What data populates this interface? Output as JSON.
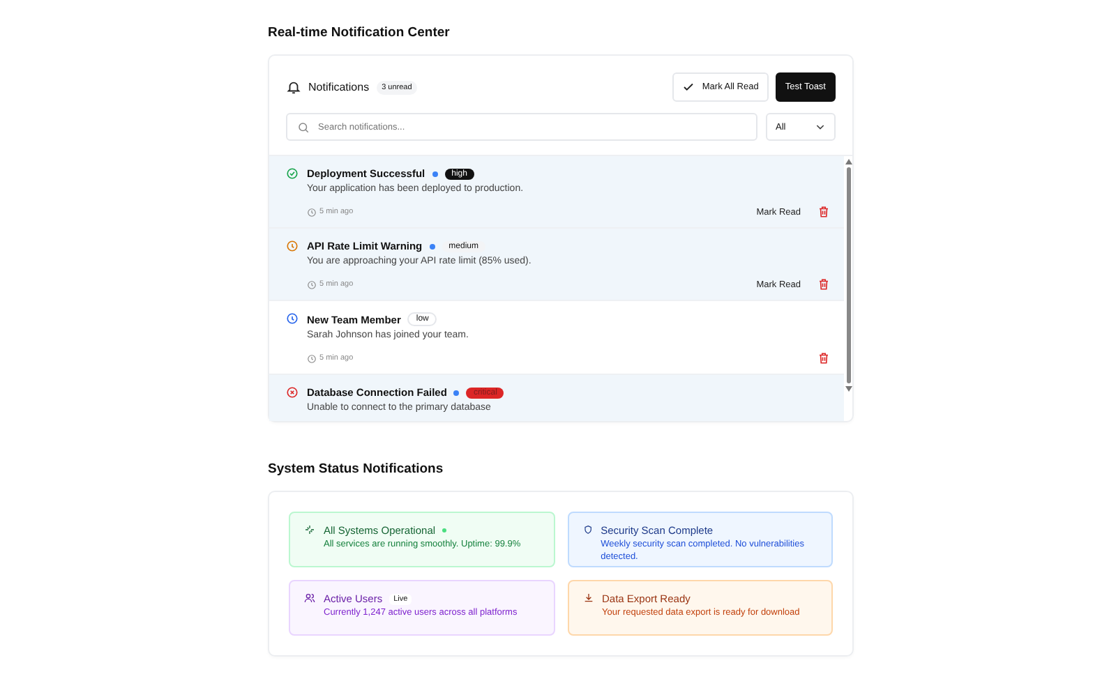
{
  "title": "Real-time Notification Center",
  "notifications_panel": {
    "heading": "Notifications",
    "unread_badge": "3 unread",
    "mark_all_button": "Mark All Read",
    "toast_button": "Test Toast",
    "search": {
      "placeholder": "Search notifications..."
    },
    "filter": {
      "value": "All"
    },
    "items": [
      {
        "kind": "success",
        "title": "Deployment Successful",
        "unread": true,
        "priority": "high",
        "message": "Your application has been deployed to production.",
        "time": "5 min ago",
        "mark_read": "Mark Read"
      },
      {
        "kind": "warning",
        "title": "API Rate Limit Warning",
        "unread": true,
        "priority": "medium",
        "message": "You are approaching your API rate limit (85% used).",
        "time": "5 min ago",
        "mark_read": "Mark Read"
      },
      {
        "kind": "info",
        "title": "New Team Member",
        "unread": false,
        "priority": "low",
        "message": "Sarah Johnson has joined your team.",
        "time": "5 min ago"
      },
      {
        "kind": "error",
        "title": "Database Connection Failed",
        "unread": true,
        "priority": "critical",
        "message": "Unable to connect to the primary database"
      }
    ]
  },
  "status_heading": "System Status Notifications",
  "status_cards": [
    {
      "kind": "success",
      "title": "All Systems Operational",
      "live_dot": true,
      "message": "All services are running smoothly. Uptime: 99.9%"
    },
    {
      "kind": "info",
      "title": "Security Scan Complete",
      "message": "Weekly security scan completed. No vulnerabilities detected."
    },
    {
      "kind": "users",
      "title": "Active Users",
      "badge": "Live",
      "message": "Currently 1,247 active users across all platforms"
    },
    {
      "kind": "export",
      "title": "Data Export Ready",
      "message": "Your requested data export is ready for download"
    }
  ]
}
